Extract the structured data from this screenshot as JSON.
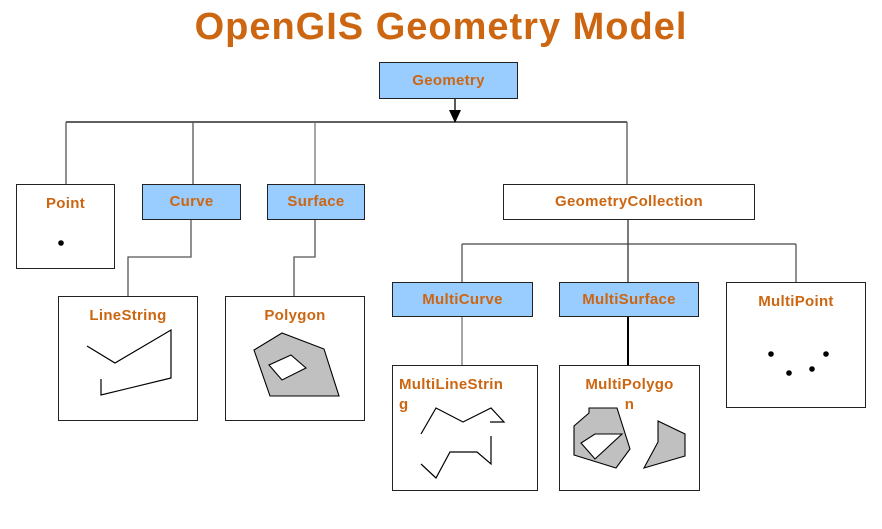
{
  "title": "OpenGIS Geometry Model",
  "colors": {
    "label_text": "#cc6611",
    "abstract_fill": "#99ccff",
    "shape_fill": "#c0c0c0",
    "line": "#000000"
  },
  "nodes": {
    "geometry": {
      "label": "Geometry",
      "abstract": true
    },
    "point": {
      "label": "Point",
      "abstract": false
    },
    "curve": {
      "label": "Curve",
      "abstract": true
    },
    "surface": {
      "label": "Surface",
      "abstract": true
    },
    "geometry_collection": {
      "label": "GeometryCollection",
      "abstract": false
    },
    "linestring": {
      "label": "LineString",
      "abstract": false
    },
    "polygon": {
      "label": "Polygon",
      "abstract": false
    },
    "multicurve": {
      "label": "MultiCurve",
      "abstract": true
    },
    "multisurface": {
      "label": "MultiSurface",
      "abstract": true
    },
    "multipoint": {
      "label": "MultiPoint",
      "abstract": false
    },
    "multilinestring": {
      "label": "MultiLineStrin\ng",
      "abstract": false
    },
    "multipolygon": {
      "label": "MultiPolygo\nn",
      "abstract": false
    }
  },
  "edges": [
    [
      "geometry",
      "point"
    ],
    [
      "geometry",
      "curve"
    ],
    [
      "geometry",
      "surface"
    ],
    [
      "geometry",
      "geometry_collection"
    ],
    [
      "curve",
      "linestring"
    ],
    [
      "surface",
      "polygon"
    ],
    [
      "geometry_collection",
      "multicurve"
    ],
    [
      "geometry_collection",
      "multisurface"
    ],
    [
      "geometry_collection",
      "multipoint"
    ],
    [
      "multicurve",
      "multilinestring"
    ],
    [
      "multisurface",
      "multipolygon"
    ]
  ]
}
